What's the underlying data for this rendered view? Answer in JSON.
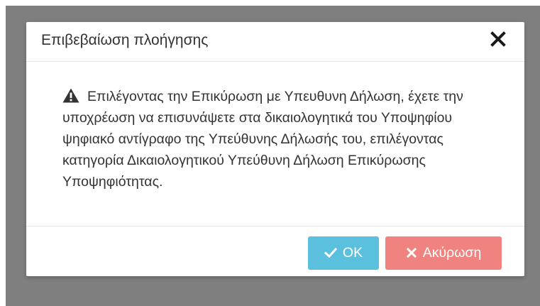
{
  "dialog": {
    "title": "Επιβεβαίωση πλοήγησης",
    "close_icon": "close-icon",
    "warning_icon": "warning-triangle-icon",
    "message": "Επιλέγοντας την Επικύρωση με Υπευθυνη Δήλωση, έχετε την υποχρέωση να επισυνάψετε στα δικαιολογητικά του Υποψηφίου ψηφιακό αντίγραφο της Υπεύθυνης Δήλωσής του, επιλέγοντας κατηγορία Δικαιολογητικού Υπεύθυνη Δήλωση Επικύρωσης Υποψηφιότητας.",
    "buttons": {
      "ok_label": "OK",
      "ok_icon": "check-icon",
      "cancel_label": "Ακύρωση",
      "cancel_icon": "x-icon"
    }
  },
  "colors": {
    "overlay": "#7f7f7f",
    "ok_button": "#5bc0de",
    "cancel_button": "#f0837f",
    "text": "#333333"
  }
}
